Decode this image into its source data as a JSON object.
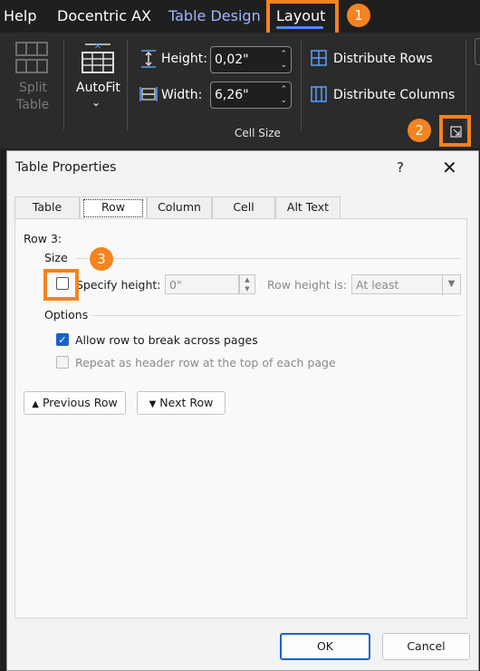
{
  "ribbon": {
    "tabs": [
      {
        "label": "Help"
      },
      {
        "label": "Docentric AX"
      },
      {
        "label": "Table Design"
      },
      {
        "label": "Layout"
      }
    ],
    "split_table": {
      "line1": "Split",
      "line2": "Table"
    },
    "autofit": {
      "label": "AutoFit"
    },
    "height": {
      "label": "Height:",
      "value": "0,02\""
    },
    "width": {
      "label": "Width:",
      "value": "6,26\""
    },
    "distribute_rows": "Distribute Rows",
    "distribute_columns": "Distribute Columns",
    "group_label": "Cell Size"
  },
  "callouts": [
    "1",
    "2",
    "3"
  ],
  "dialog": {
    "title": "Table Properties",
    "help": "?",
    "close": "✕",
    "tabs": [
      {
        "label": "Table"
      },
      {
        "label": "Row"
      },
      {
        "label": "Column"
      },
      {
        "label": "Cell"
      },
      {
        "label": "Alt Text"
      }
    ],
    "row_heading": "Row 3:",
    "size_label": "Size",
    "specify_height_label": "Specify height:",
    "height_value": "0\"",
    "row_height_is_label": "Row height is:",
    "row_height_option": "At least",
    "options_label": "Options",
    "allow_break_label": "Allow row to break across pages",
    "allow_break_checked": true,
    "repeat_header_label": "Repeat as header row at the top of each page",
    "repeat_header_checked": false,
    "previous_row": "Previous Row",
    "next_row": "Next Row",
    "ok": "OK",
    "cancel": "Cancel"
  },
  "colors": {
    "accent_orange": "#f5831f",
    "accent_blue": "#1a63c9",
    "ribbon_bg": "#2b2b2b",
    "dialog_bg": "#f3f3f3"
  }
}
